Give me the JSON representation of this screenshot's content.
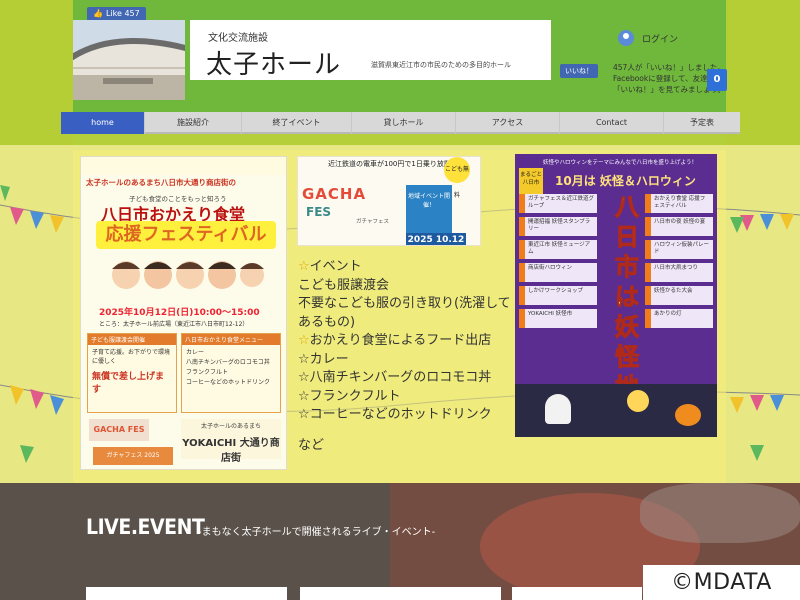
{
  "header": {
    "fb_like": {
      "label": "Like",
      "count": "457"
    },
    "title_sub": "文化交流施設",
    "title_main": "太子ホール",
    "title_desc": "滋賀県東近江市の市民のための多目的ホール",
    "login_label": "ログイン",
    "fb_like2": "いいね！",
    "fb_text": "457人が「いいね！」しました。Facebookに登録して、友達の「いいね！」を見てみましょう。",
    "cart_count": "0"
  },
  "nav": {
    "items": [
      {
        "label": "home",
        "active": true
      },
      {
        "label": "施設紹介",
        "active": false
      },
      {
        "label": "終了イベント",
        "active": false
      },
      {
        "label": "貸しホール",
        "active": false
      },
      {
        "label": "アクセス",
        "active": false
      },
      {
        "label": "Contact",
        "active": false
      },
      {
        "label": "予定表",
        "active": false
      }
    ]
  },
  "poster1": {
    "line1": "太子ホールのあるまち八日市大通り商店街の",
    "line2": "子ども食堂のことをもっと知ろう",
    "line3": "八日市おかえり食堂",
    "line4": "応援フェスティバル",
    "date": "2025年10月12日(日)10:00〜15:00",
    "place": "ところ：太子ホール前広場（東近江市八日市町12-12）",
    "box_a_label": "子ども服譲渡会開催",
    "box_a_text": "子育て応援。お下がりで環境に優しく",
    "box_a_big": "無償で差し上げます",
    "box_b_label": "八日市おかえり食堂メニュー",
    "box_b_items": [
      "カレー",
      "八南チキンバーグのロコモコ丼",
      "フランクフルト",
      "コーヒーなどのホットドリンク"
    ],
    "gacha": "GACHA FES",
    "bottom_top": "太子ホールのあるまち",
    "bottom_logo": "YOKAICHI 大通り商店街",
    "orange": "ガチャフェス 2025"
  },
  "poster2": {
    "head": "近江鉄道の電車が100円で1日乗り放題！",
    "gacha": "GACHA",
    "fes": "FES",
    "blue_text": "地域イベント開催！",
    "badge": "こども無料",
    "date": "2025 10.12",
    "mini": "ガチャフェス"
  },
  "event_text": {
    "lines": [
      {
        "star": true,
        "text": "イベント"
      },
      {
        "star": false,
        "text": "こども服譲渡会"
      },
      {
        "star": false,
        "text": "不要なこども服の引き取り(洗濯して"
      },
      {
        "star": false,
        "text": "あるもの)"
      },
      {
        "star": true,
        "text": "おかえり食堂によるフード出店"
      },
      {
        "star": false,
        "text": "☆カレー"
      },
      {
        "star": false,
        "text": "☆八南チキンバーグのロコモコ丼"
      },
      {
        "star": false,
        "text": "☆フランクフルト"
      },
      {
        "star": false,
        "text": "☆コーヒーなどのホットドリンク"
      }
    ],
    "etc": "など"
  },
  "poster3": {
    "head": "妖怪やハロウィンをテーマにみんなで八日市を盛り上げよう！",
    "badge": "まるごと八日市",
    "title": "10月は 妖怪＆ハロウィン",
    "vertical": "八日市は妖怪地",
    "left_items": [
      "ガチャフェス＆近江鉄道グループ",
      "開運招福 妖怪スタンプラリー",
      "東近江市 妖怪ミュージアム",
      "商店街ハロウィン",
      "しかけワークショップ",
      "YOKAICHI 妖怪市"
    ],
    "right_items": [
      "おかえり食堂 応援フェスティバル",
      "八日市の夜 妖怪の宴",
      "ハロウィン仮装パレード",
      "八日市大凧まつり",
      "妖怪かるた大会",
      "あかりの灯"
    ]
  },
  "live": {
    "title": "LIVE.EVENT",
    "subtitle": "-まもなく太子ホールで開催されるライブ・イベント-"
  },
  "watermark": "©MDATA",
  "colors": {
    "header_green": "#6fb83c",
    "side_green": "#b6ce36",
    "nav_active": "#3a5fc2",
    "facebook": "#4267b2",
    "poster3_purple": "#5b2d91"
  }
}
